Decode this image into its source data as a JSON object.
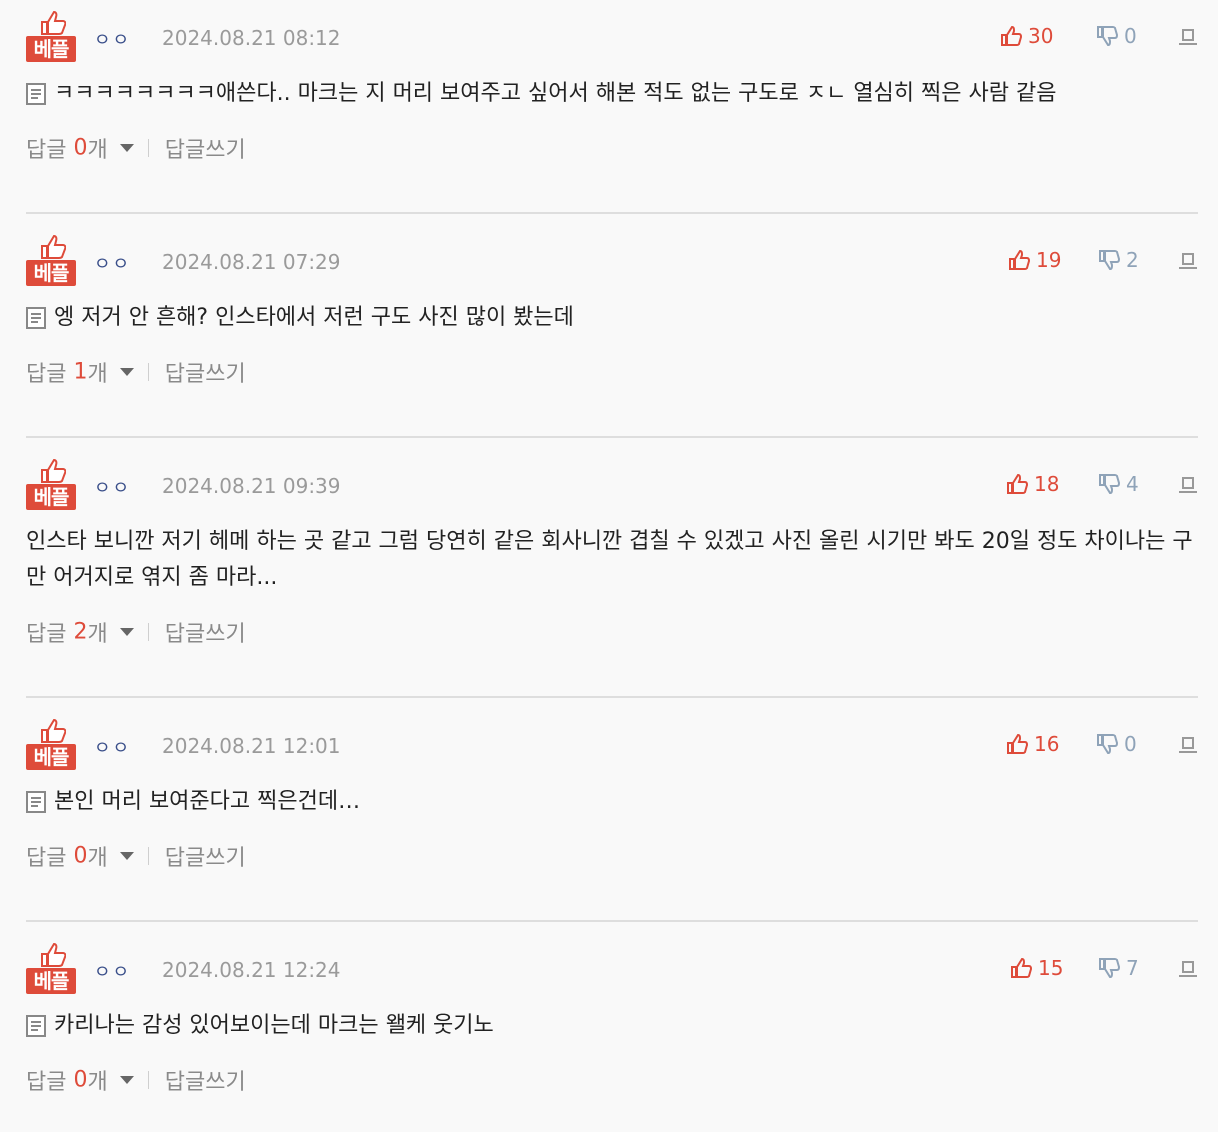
{
  "comments": [
    {
      "badge": "베플",
      "author": "ㅇㅇ",
      "time": "2024.08.21 08:12",
      "up": "30",
      "down": "0",
      "text": "ㅋㅋㅋㅋㅋㅋㅋㅋ애쓴다.. 마크는 지 머리 보여주고 싶어서 해본 적도 없는 구도로 ㅈㄴ 열심히 찍은 사람 같음",
      "has_doc_icon": true,
      "reply_label": "답글",
      "reply_count": "0",
      "reply_unit": "개",
      "write_label": "답글쓰기"
    },
    {
      "badge": "베플",
      "author": "ㅇㅇ",
      "time": "2024.08.21 07:29",
      "up": "19",
      "down": "2",
      "text": "엥 저거 안 흔해? 인스타에서 저런 구도 사진 많이 봤는데",
      "has_doc_icon": true,
      "reply_label": "답글",
      "reply_count": "1",
      "reply_unit": "개",
      "write_label": "답글쓰기"
    },
    {
      "badge": "베플",
      "author": "ㅇㅇ",
      "time": "2024.08.21 09:39",
      "up": "18",
      "down": "4",
      "text": "인스타 보니깐 저기 헤메 하는 곳 같고 그럼 당연히 같은 회사니깐 겹칠 수 있겠고 사진 올린 시기만 봐도 20일 정도 차이나는 구만 어거지로 엮지 좀 마라...",
      "has_doc_icon": false,
      "reply_label": "답글",
      "reply_count": "2",
      "reply_unit": "개",
      "write_label": "답글쓰기"
    },
    {
      "badge": "베플",
      "author": "ㅇㅇ",
      "time": "2024.08.21 12:01",
      "up": "16",
      "down": "0",
      "text": "본인 머리 보여준다고 찍은건데…",
      "has_doc_icon": true,
      "reply_label": "답글",
      "reply_count": "0",
      "reply_unit": "개",
      "write_label": "답글쓰기"
    },
    {
      "badge": "베플",
      "author": "ㅇㅇ",
      "time": "2024.08.21 12:24",
      "up": "15",
      "down": "7",
      "text": "카리나는 감성 있어보이는데 마크는 왤케 웃기노",
      "has_doc_icon": true,
      "reply_label": "답글",
      "reply_count": "0",
      "reply_unit": "개",
      "write_label": "답글쓰기"
    }
  ],
  "colors": {
    "accent": "#de4b3a",
    "down": "#8fa3b8",
    "author": "#3a4f8a"
  },
  "icons": [
    "thumbs-up-icon",
    "thumbs-down-icon",
    "report-icon",
    "document-icon",
    "caret-down-icon"
  ]
}
